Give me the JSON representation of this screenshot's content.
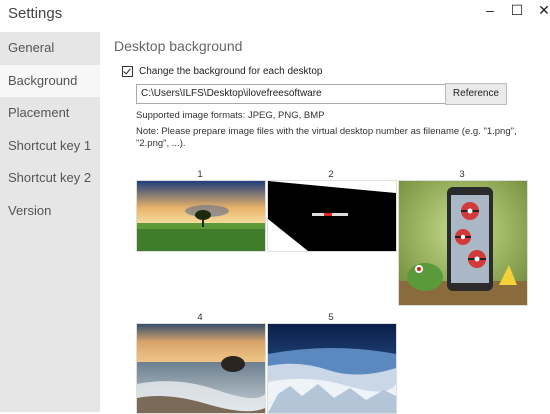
{
  "window": {
    "title": "Settings",
    "minimize_glyph": "–",
    "maximize_glyph": "☐",
    "close_glyph": "✕"
  },
  "sidebar": {
    "items": [
      {
        "label": "General"
      },
      {
        "label": "Background",
        "active": true
      },
      {
        "label": "Placement"
      },
      {
        "label": "Shortcut key 1"
      },
      {
        "label": "Shortcut key 2"
      },
      {
        "label": "Version"
      }
    ]
  },
  "main": {
    "heading": "Desktop background",
    "checkbox_label": "Change the background for each desktop",
    "checkbox_checked": true,
    "path_value": "C:\\Users\\ILFS\\Desktop\\ilovefreesoftware",
    "reference_button": "Reference",
    "formats_text": "Supported image formats: JPEG, PNG, BMP",
    "note_text": "Note: Please prepare image files with the virtual desktop number as filename (e.g. \"1.png\", \"2.png\", ...).",
    "thumbnails": [
      {
        "number": "1"
      },
      {
        "number": "2"
      },
      {
        "number": "3"
      },
      {
        "number": "4"
      },
      {
        "number": "5"
      }
    ]
  },
  "colors": {
    "sidebar_bg": "#e6e6e6",
    "sidebar_active_bg": "#f7f7f7",
    "accent": "#0078d7"
  }
}
